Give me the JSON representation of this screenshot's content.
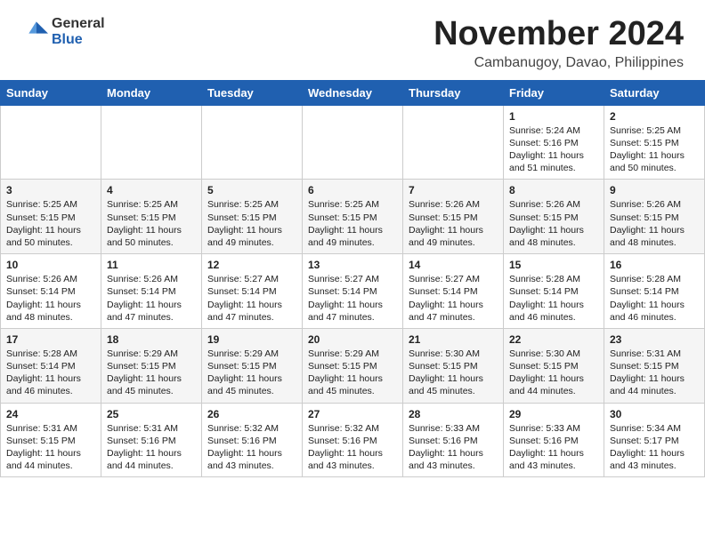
{
  "header": {
    "logo_general": "General",
    "logo_blue": "Blue",
    "month_title": "November 2024",
    "location": "Cambanugoy, Davao, Philippines"
  },
  "days_of_week": [
    "Sunday",
    "Monday",
    "Tuesday",
    "Wednesday",
    "Thursday",
    "Friday",
    "Saturday"
  ],
  "weeks": [
    [
      {
        "day": "",
        "info": ""
      },
      {
        "day": "",
        "info": ""
      },
      {
        "day": "",
        "info": ""
      },
      {
        "day": "",
        "info": ""
      },
      {
        "day": "",
        "info": ""
      },
      {
        "day": "1",
        "info": "Sunrise: 5:24 AM\nSunset: 5:16 PM\nDaylight: 11 hours\nand 51 minutes."
      },
      {
        "day": "2",
        "info": "Sunrise: 5:25 AM\nSunset: 5:15 PM\nDaylight: 11 hours\nand 50 minutes."
      }
    ],
    [
      {
        "day": "3",
        "info": "Sunrise: 5:25 AM\nSunset: 5:15 PM\nDaylight: 11 hours\nand 50 minutes."
      },
      {
        "day": "4",
        "info": "Sunrise: 5:25 AM\nSunset: 5:15 PM\nDaylight: 11 hours\nand 50 minutes."
      },
      {
        "day": "5",
        "info": "Sunrise: 5:25 AM\nSunset: 5:15 PM\nDaylight: 11 hours\nand 49 minutes."
      },
      {
        "day": "6",
        "info": "Sunrise: 5:25 AM\nSunset: 5:15 PM\nDaylight: 11 hours\nand 49 minutes."
      },
      {
        "day": "7",
        "info": "Sunrise: 5:26 AM\nSunset: 5:15 PM\nDaylight: 11 hours\nand 49 minutes."
      },
      {
        "day": "8",
        "info": "Sunrise: 5:26 AM\nSunset: 5:15 PM\nDaylight: 11 hours\nand 48 minutes."
      },
      {
        "day": "9",
        "info": "Sunrise: 5:26 AM\nSunset: 5:15 PM\nDaylight: 11 hours\nand 48 minutes."
      }
    ],
    [
      {
        "day": "10",
        "info": "Sunrise: 5:26 AM\nSunset: 5:14 PM\nDaylight: 11 hours\nand 48 minutes."
      },
      {
        "day": "11",
        "info": "Sunrise: 5:26 AM\nSunset: 5:14 PM\nDaylight: 11 hours\nand 47 minutes."
      },
      {
        "day": "12",
        "info": "Sunrise: 5:27 AM\nSunset: 5:14 PM\nDaylight: 11 hours\nand 47 minutes."
      },
      {
        "day": "13",
        "info": "Sunrise: 5:27 AM\nSunset: 5:14 PM\nDaylight: 11 hours\nand 47 minutes."
      },
      {
        "day": "14",
        "info": "Sunrise: 5:27 AM\nSunset: 5:14 PM\nDaylight: 11 hours\nand 47 minutes."
      },
      {
        "day": "15",
        "info": "Sunrise: 5:28 AM\nSunset: 5:14 PM\nDaylight: 11 hours\nand 46 minutes."
      },
      {
        "day": "16",
        "info": "Sunrise: 5:28 AM\nSunset: 5:14 PM\nDaylight: 11 hours\nand 46 minutes."
      }
    ],
    [
      {
        "day": "17",
        "info": "Sunrise: 5:28 AM\nSunset: 5:14 PM\nDaylight: 11 hours\nand 46 minutes."
      },
      {
        "day": "18",
        "info": "Sunrise: 5:29 AM\nSunset: 5:15 PM\nDaylight: 11 hours\nand 45 minutes."
      },
      {
        "day": "19",
        "info": "Sunrise: 5:29 AM\nSunset: 5:15 PM\nDaylight: 11 hours\nand 45 minutes."
      },
      {
        "day": "20",
        "info": "Sunrise: 5:29 AM\nSunset: 5:15 PM\nDaylight: 11 hours\nand 45 minutes."
      },
      {
        "day": "21",
        "info": "Sunrise: 5:30 AM\nSunset: 5:15 PM\nDaylight: 11 hours\nand 45 minutes."
      },
      {
        "day": "22",
        "info": "Sunrise: 5:30 AM\nSunset: 5:15 PM\nDaylight: 11 hours\nand 44 minutes."
      },
      {
        "day": "23",
        "info": "Sunrise: 5:31 AM\nSunset: 5:15 PM\nDaylight: 11 hours\nand 44 minutes."
      }
    ],
    [
      {
        "day": "24",
        "info": "Sunrise: 5:31 AM\nSunset: 5:15 PM\nDaylight: 11 hours\nand 44 minutes."
      },
      {
        "day": "25",
        "info": "Sunrise: 5:31 AM\nSunset: 5:16 PM\nDaylight: 11 hours\nand 44 minutes."
      },
      {
        "day": "26",
        "info": "Sunrise: 5:32 AM\nSunset: 5:16 PM\nDaylight: 11 hours\nand 43 minutes."
      },
      {
        "day": "27",
        "info": "Sunrise: 5:32 AM\nSunset: 5:16 PM\nDaylight: 11 hours\nand 43 minutes."
      },
      {
        "day": "28",
        "info": "Sunrise: 5:33 AM\nSunset: 5:16 PM\nDaylight: 11 hours\nand 43 minutes."
      },
      {
        "day": "29",
        "info": "Sunrise: 5:33 AM\nSunset: 5:16 PM\nDaylight: 11 hours\nand 43 minutes."
      },
      {
        "day": "30",
        "info": "Sunrise: 5:34 AM\nSunset: 5:17 PM\nDaylight: 11 hours\nand 43 minutes."
      }
    ]
  ]
}
